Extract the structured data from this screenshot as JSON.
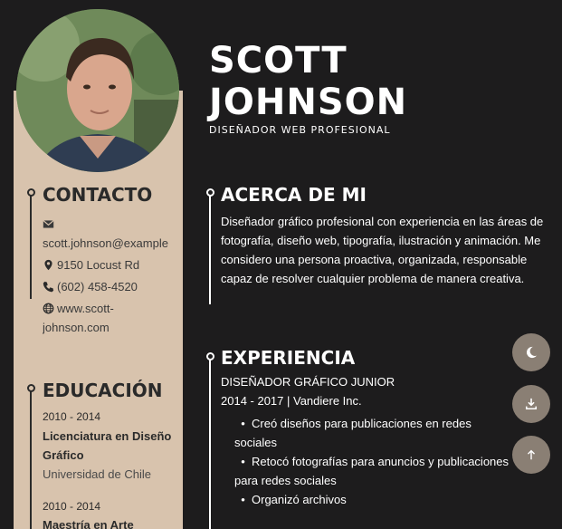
{
  "header": {
    "name_line1": "SCOTT",
    "name_line2": "JOHNSON",
    "subtitle": "DISEÑADOR WEB PROFESIONAL"
  },
  "contact": {
    "heading": "CONTACTO",
    "email": "scott.johnson@example.c",
    "address": "9150 Locust Rd",
    "phone": "(602) 458-4520",
    "website": "www.scott-johnson.com",
    "icons": [
      "envelope-icon",
      "map-pin-icon",
      "phone-icon",
      "globe-icon"
    ]
  },
  "education": {
    "heading": "EDUCACIÓN",
    "items": [
      {
        "date": "2010 - 2014",
        "title": "Licenciatura en Diseño Gráfico",
        "school": "Universidad de Chile"
      },
      {
        "date": "2010 - 2014",
        "title": "Maestría en Arte",
        "school": ""
      }
    ]
  },
  "about": {
    "heading": "ACERCA DE MI",
    "text": "Diseñador gráfico profesional con experiencia en las áreas de fotografía, diseño web, tipografía, ilustración y animación. Me considero una persona proactiva, organizada, responsable capaz de resolver cualquier problema de manera creativa."
  },
  "experience": {
    "heading": "EXPERIENCIA",
    "jobs": [
      {
        "title": "DISEÑADOR GRÁFICO JUNIOR",
        "date": "2014 - 2017 | Vandiere Inc.",
        "tasks": [
          "Creó diseños para publicaciones en redes sociales",
          "Retocó fotografías para anuncios y publicaciones para redes sociales",
          "Organizó archivos"
        ]
      }
    ]
  },
  "fabs": [
    {
      "name": "dark-mode-button",
      "icon": "moon-icon"
    },
    {
      "name": "download-button",
      "icon": "download-icon"
    },
    {
      "name": "scroll-top-button",
      "icon": "arrow-up-icon"
    }
  ],
  "colors": {
    "background": "#1d1c1d",
    "sidebar": "#d8c3ad",
    "fab": "#8a7f74",
    "text_light": "#ffffff",
    "text_dark": "#2a2a2a"
  }
}
